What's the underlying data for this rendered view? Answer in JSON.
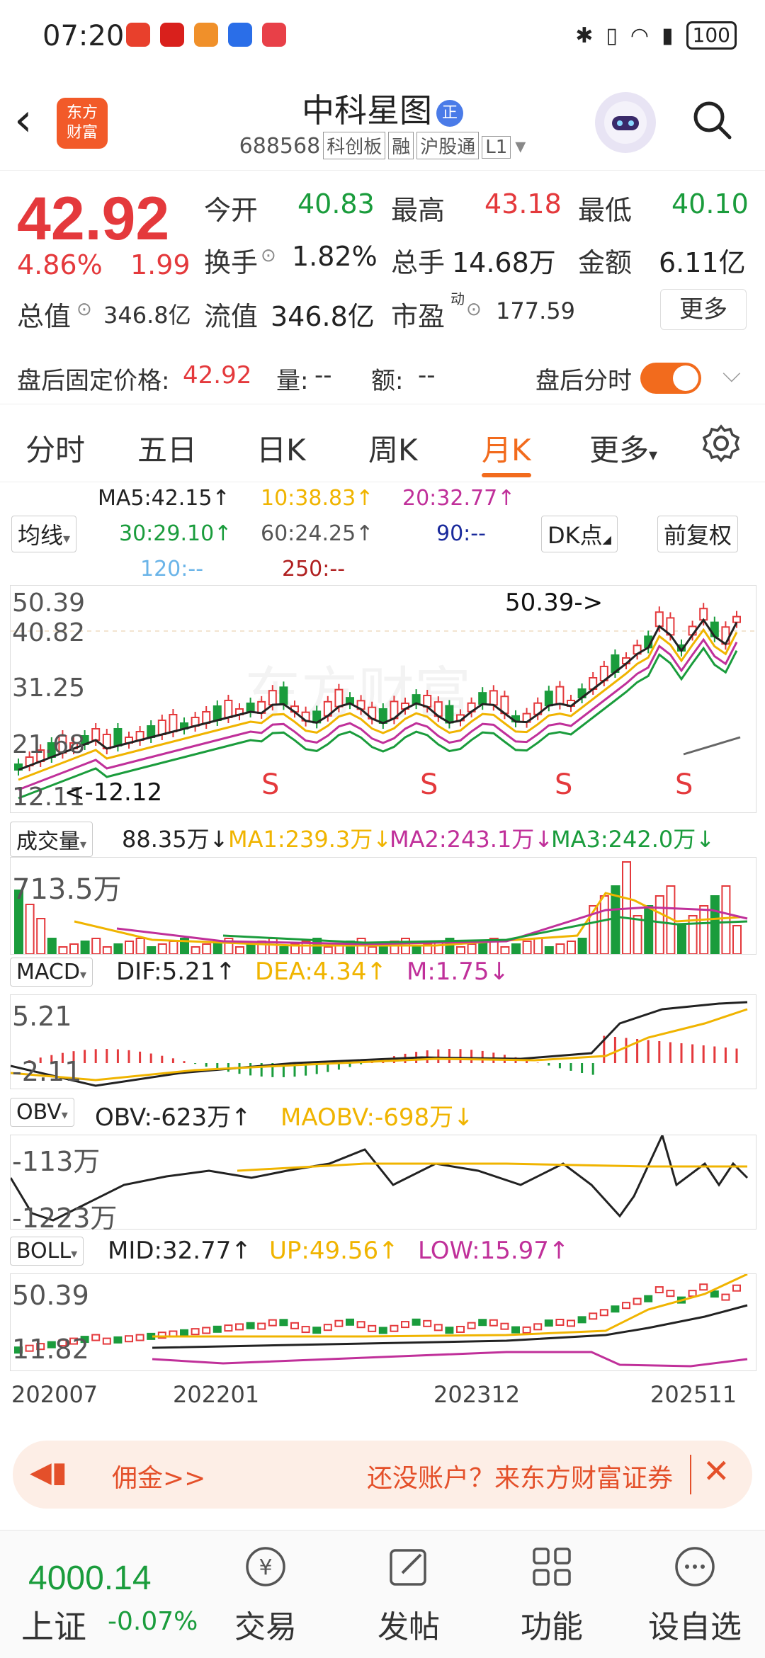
{
  "status_bar": {
    "time": "07:20",
    "battery": "100"
  },
  "header": {
    "logo_text_1": "东方",
    "logo_text_2": "财富",
    "stock_name": "中科星图",
    "badge": "正",
    "code": "688568",
    "tags": [
      "科创板",
      "融",
      "沪股通",
      "L1"
    ]
  },
  "quote": {
    "price": "42.92",
    "change_pct": "4.86%",
    "change": "1.99",
    "open_label": "今开",
    "open": "40.83",
    "high_label": "最高",
    "high": "43.18",
    "low_label": "最低",
    "low": "40.10",
    "turnover_label": "换手",
    "turnover": "1.82%",
    "volume_label": "总手",
    "volume": "14.68万",
    "amount_label": "金额",
    "amount": "6.11亿",
    "mktcap_label": "总值",
    "mktcap": "346.8亿",
    "float_label": "流值",
    "float": "346.8亿",
    "pe_label": "市盈",
    "pe_sup": "动",
    "pe": "177.59",
    "more": "更多"
  },
  "after_hours": {
    "price_label": "盘后固定价格:",
    "price": "42.92",
    "vol_label": "量:",
    "vol": "--",
    "amt_label": "额:",
    "amt": "--",
    "toggle_label": "盘后分时"
  },
  "tabs": [
    "分时",
    "五日",
    "日K",
    "周K",
    "月K",
    "更多"
  ],
  "active_tab": "月K",
  "ma": {
    "ma5": "MA5:42.15",
    "ma10": "10:38.83",
    "ma20": "20:32.77",
    "ma30": "30:29.10",
    "ma60": "60:24.25",
    "ma90": "90:--",
    "ma120": "120:--",
    "ma250": "250:--",
    "selector": "均线",
    "dk": "DK点",
    "fq": "前复权"
  },
  "kline_axis": {
    "y1": "50.39",
    "y2": "40.82",
    "y3": "31.25",
    "y4": "21.68",
    "y5": "12.11",
    "peak_label": "50.39->",
    "low_label": "<-12.12",
    "watermark": "东方财富"
  },
  "volume_panel": {
    "selector": "成交量",
    "vol": "88.35万",
    "ma1": "MA1:239.3万",
    "ma2": "MA2:243.1万",
    "ma3": "MA3:242.0万",
    "axis": "713.5万"
  },
  "macd_panel": {
    "selector": "MACD",
    "dif": "DIF:5.21",
    "dea": "DEA:4.34",
    "m": "M:1.75",
    "axis_top": "5.21",
    "axis_bottom": "-2.11"
  },
  "obv_panel": {
    "selector": "OBV",
    "obv": "OBV:-623万",
    "maobv": "MAOBV:-698万",
    "axis_top": "-113万",
    "axis_bottom": "-1223万"
  },
  "boll_panel": {
    "selector": "BOLL",
    "mid": "MID:32.77",
    "up": "UP:49.56",
    "low": "LOW:15.97",
    "axis_top": "50.39",
    "axis_bottom": "11.82"
  },
  "x_axis": [
    "202007",
    "202201",
    "202312",
    "202511"
  ],
  "ad": {
    "left": "佣金>>",
    "right": "还没账户？来东方财富证券"
  },
  "bottom_nav": {
    "index_value": "4000.14",
    "index_name": "上证",
    "index_change": "-0.07%",
    "items": [
      "交易",
      "发帖",
      "功能",
      "设自选"
    ]
  },
  "colors": {
    "red": "#e4393c",
    "green": "#1a9c3c",
    "orange": "#f26b1d",
    "ma10": "#f0b400",
    "ma20": "#c0309a",
    "ma30": "#1a9c3c",
    "ma90": "#1a2a9c",
    "ma120": "#6ab4e8",
    "ma250": "#b02020"
  }
}
